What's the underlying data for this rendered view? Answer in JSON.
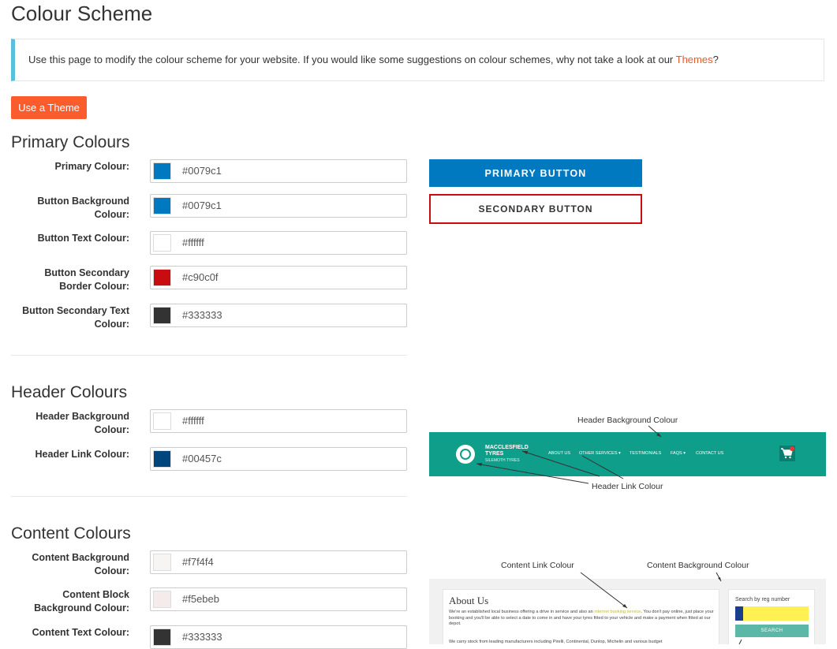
{
  "page": {
    "title": "Colour Scheme",
    "info_text": "Use this page to modify the colour scheme for your website. If you would like some suggestions on colour schemes, why not take a look at our ",
    "info_link": "Themes",
    "info_suffix": "?",
    "theme_button": "Use a Theme"
  },
  "primary": {
    "title": "Primary Colours",
    "fields": [
      {
        "label": "Primary Colour:",
        "value": "#0079c1"
      },
      {
        "label": "Button Background Colour:",
        "value": "#0079c1"
      },
      {
        "label": "Button Text Colour:",
        "value": "#ffffff"
      },
      {
        "label": "Button Secondary Border Colour:",
        "value": "#c90c0f"
      },
      {
        "label": "Button Secondary Text Colour:",
        "value": "#333333"
      }
    ],
    "preview": {
      "primary_button": "PRIMARY BUTTON",
      "secondary_button": "SECONDARY BUTTON"
    }
  },
  "header": {
    "title": "Header Colours",
    "fields": [
      {
        "label": "Header Background Colour:",
        "value": "#ffffff"
      },
      {
        "label": "Header Link Colour:",
        "value": "#00457c"
      }
    ],
    "preview": {
      "bg_annotation": "Header Background Colour",
      "link_annotation": "Header Link Colour",
      "brand_line1": "MACCLESFIELD",
      "brand_line2": "TYRES",
      "brand_sub": "SILEMOTH TYRES",
      "nav": [
        "ABOUT US",
        "OTHER SERVICES ▾",
        "TESTIMONIALS",
        "FAQS ▾",
        "CONTACT US"
      ],
      "cart_icon": "cart-icon"
    }
  },
  "content": {
    "title": "Content Colours",
    "fields": [
      {
        "label": "Content Background Colour:",
        "value": "#f7f4f4"
      },
      {
        "label": "Content Block Background Colour:",
        "value": "#f5ebeb"
      },
      {
        "label": "Content Text Colour:",
        "value": "#333333"
      }
    ],
    "preview": {
      "link_annotation": "Content Link Colour",
      "bg_annotation": "Content Background Colour",
      "block_title": "About Us",
      "block_text_1": "We're an established local business offering a drive in service and also an ",
      "block_link": "internet booking service",
      "block_text_2": ". You don't pay online, just place your booking and you'll be able to select a date to come in and have your tyres fitted to your vehicle and make a payment when fitted at our depot.",
      "block_text_3": "We carry stock from leading manufacturers including Pirelli, Continental, Dunlop, Michelin and various budget",
      "search_label": "Search by reg number",
      "search_button": "SEARCH"
    }
  },
  "swatch_colors": {
    "primary": [
      "#0079c1",
      "#0079c1",
      "#ffffff",
      "#c90c0f",
      "#333333"
    ],
    "header": [
      "#ffffff",
      "#00457c"
    ],
    "content": [
      "#f7f4f4",
      "#f5ebeb",
      "#333333"
    ]
  }
}
